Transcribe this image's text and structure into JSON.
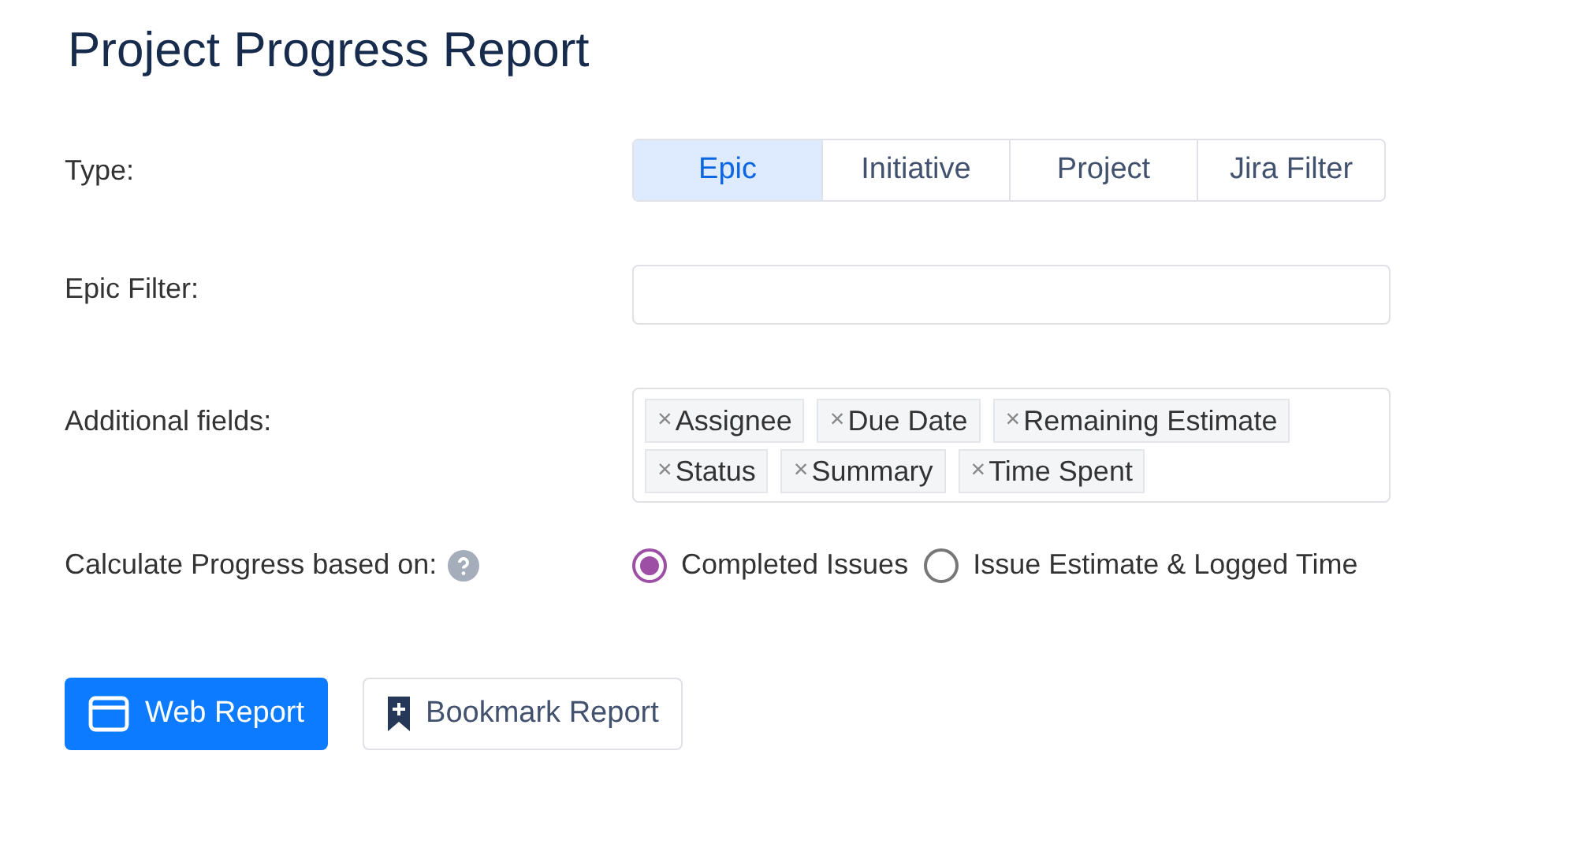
{
  "title": "Project Progress Report",
  "type_row": {
    "label": "Type:",
    "tabs": [
      {
        "label": "Epic",
        "selected": true
      },
      {
        "label": "Initiative",
        "selected": false
      },
      {
        "label": "Project",
        "selected": false
      },
      {
        "label": "Jira Filter",
        "selected": false
      }
    ]
  },
  "filter_row": {
    "label": "Epic Filter:"
  },
  "fields_row": {
    "label": "Additional fields:",
    "tags": [
      {
        "remove": "×",
        "label": "Assignee"
      },
      {
        "remove": "×",
        "label": "Due Date"
      },
      {
        "remove": "×",
        "label": "Remaining Estimate"
      },
      {
        "remove": "×",
        "label": "Status"
      },
      {
        "remove": "×",
        "label": "Summary"
      },
      {
        "remove": "×",
        "label": "Time Spent"
      }
    ]
  },
  "progress_row": {
    "label": "Calculate Progress based on:",
    "options": [
      {
        "label": "Completed Issues",
        "selected": true
      },
      {
        "label": "Issue Estimate & Logged Time",
        "selected": false
      }
    ]
  },
  "buttons": [
    {
      "kind": "primary",
      "label": "Web Report"
    },
    {
      "kind": "secondary",
      "label": "Bookmark Report"
    }
  ]
}
